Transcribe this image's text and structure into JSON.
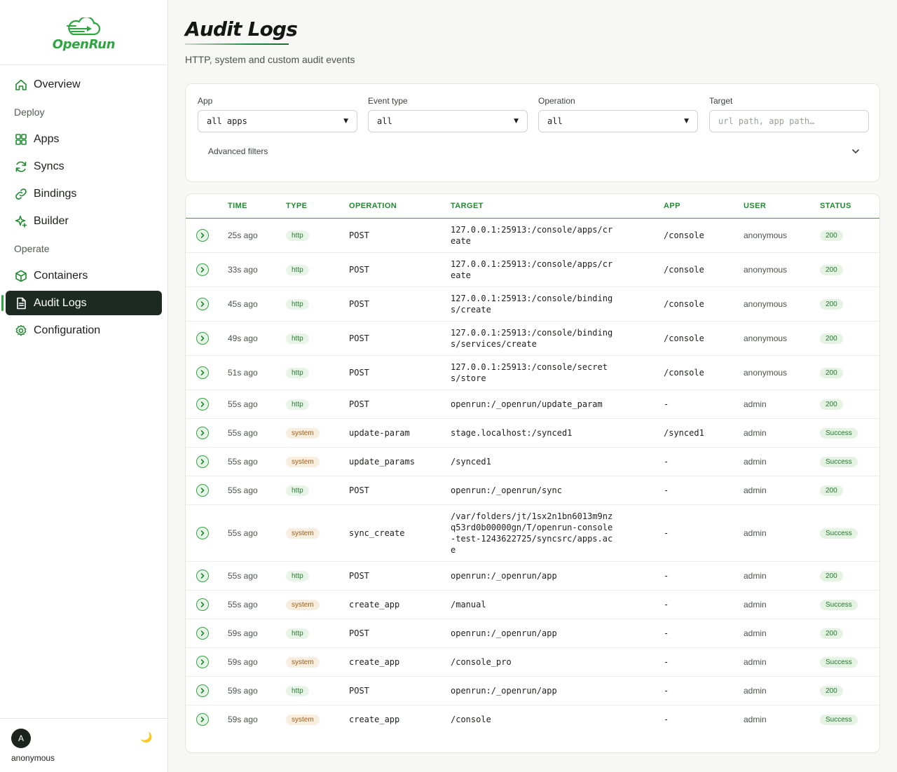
{
  "brand": {
    "name": "OpenRun"
  },
  "nav": {
    "items": [
      {
        "label": "Overview",
        "icon": "home-icon"
      },
      {
        "section": "Deploy"
      },
      {
        "label": "Apps",
        "icon": "grid-icon"
      },
      {
        "label": "Syncs",
        "icon": "refresh-icon"
      },
      {
        "label": "Bindings",
        "icon": "link-icon"
      },
      {
        "label": "Builder",
        "icon": "sparkle-icon"
      },
      {
        "section": "Operate"
      },
      {
        "label": "Containers",
        "icon": "box-icon"
      },
      {
        "label": "Audit Logs",
        "icon": "document-icon",
        "active": true
      },
      {
        "label": "Configuration",
        "icon": "gear-icon"
      }
    ]
  },
  "user": {
    "initial": "A",
    "name": "anonymous",
    "theme_icon": "moon-icon"
  },
  "page": {
    "title": "Audit Logs",
    "subtitle": "HTTP, system and custom audit events"
  },
  "filters": {
    "app": {
      "label": "App",
      "value": "all apps"
    },
    "event_type": {
      "label": "Event type",
      "value": "all"
    },
    "operation": {
      "label": "Operation",
      "value": "all"
    },
    "target": {
      "label": "Target",
      "placeholder": "url path, app path…"
    },
    "advanced_label": "Advanced filters"
  },
  "table": {
    "columns": [
      "TIME",
      "TYPE",
      "OPERATION",
      "TARGET",
      "APP",
      "USER",
      "STATUS"
    ],
    "rows": [
      {
        "time": "25s ago",
        "type": "http",
        "operation": "POST",
        "target": "127.0.0.1:25913:/console/apps/create",
        "app": "/console",
        "user": "anonymous",
        "status": "200",
        "size": "md"
      },
      {
        "time": "33s ago",
        "type": "http",
        "operation": "POST",
        "target": "127.0.0.1:25913:/console/apps/create",
        "app": "/console",
        "user": "anonymous",
        "status": "200",
        "size": "md"
      },
      {
        "time": "45s ago",
        "type": "http",
        "operation": "POST",
        "target": "127.0.0.1:25913:/console/bindings/create",
        "app": "/console",
        "user": "anonymous",
        "status": "200",
        "size": "md"
      },
      {
        "time": "49s ago",
        "type": "http",
        "operation": "POST",
        "target": "127.0.0.1:25913:/console/bindings/services/create",
        "app": "/console",
        "user": "anonymous",
        "status": "200",
        "size": "md"
      },
      {
        "time": "51s ago",
        "type": "http",
        "operation": "POST",
        "target": "127.0.0.1:25913:/console/secrets/store",
        "app": "/console",
        "user": "anonymous",
        "status": "200",
        "size": "md"
      },
      {
        "time": "55s ago",
        "type": "http",
        "operation": "POST",
        "target": "openrun:/_openrun/update_param",
        "app": "-",
        "user": "admin",
        "status": "200",
        "size": "sm"
      },
      {
        "time": "55s ago",
        "type": "system",
        "operation": "update-param",
        "target": "stage.localhost:/synced1",
        "app": "/synced1",
        "user": "admin",
        "status": "Success",
        "size": "sm"
      },
      {
        "time": "55s ago",
        "type": "system",
        "operation": "update_params",
        "target": "/synced1",
        "app": "-",
        "user": "admin",
        "status": "Success",
        "size": "sm"
      },
      {
        "time": "55s ago",
        "type": "http",
        "operation": "POST",
        "target": "openrun:/_openrun/sync",
        "app": "-",
        "user": "admin",
        "status": "200",
        "size": "sm"
      },
      {
        "time": "55s ago",
        "type": "system",
        "operation": "sync_create",
        "target": "/var/folders/jt/1sx2n1bn6013m9nzq53rd0b00000gn/T/openrun-console-test-1243622725/syncsrc/apps.ace",
        "app": "-",
        "user": "admin",
        "status": "Success",
        "size": "lg"
      },
      {
        "time": "55s ago",
        "type": "http",
        "operation": "POST",
        "target": "openrun:/_openrun/app",
        "app": "-",
        "user": "admin",
        "status": "200",
        "size": "sm"
      },
      {
        "time": "55s ago",
        "type": "system",
        "operation": "create_app",
        "target": "/manual",
        "app": "-",
        "user": "admin",
        "status": "Success",
        "size": "sm"
      },
      {
        "time": "59s ago",
        "type": "http",
        "operation": "POST",
        "target": "openrun:/_openrun/app",
        "app": "-",
        "user": "admin",
        "status": "200",
        "size": "sm"
      },
      {
        "time": "59s ago",
        "type": "system",
        "operation": "create_app",
        "target": "/console_pro",
        "app": "-",
        "user": "admin",
        "status": "Success",
        "size": "sm"
      },
      {
        "time": "59s ago",
        "type": "http",
        "operation": "POST",
        "target": "openrun:/_openrun/app",
        "app": "-",
        "user": "admin",
        "status": "200",
        "size": "sm"
      },
      {
        "time": "59s ago",
        "type": "system",
        "operation": "create_app",
        "target": "/console",
        "app": "-",
        "user": "admin",
        "status": "Success",
        "size": "sm"
      }
    ]
  }
}
